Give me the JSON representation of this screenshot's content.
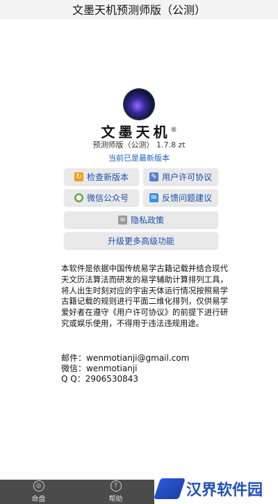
{
  "window": {
    "title": "文墨天机预测师版（公测）"
  },
  "about": {
    "brand": "文墨天机",
    "registered": "®",
    "version": "预测师版（公测） 1.7.8 zt",
    "latest_status": "当前已是最新版本"
  },
  "buttons": {
    "check_update": "检查新版本",
    "user_agreement": "用户许可协议",
    "wechat": "微信公众号",
    "feedback": "反馈问题建议",
    "privacy": "隐私政策",
    "upgrade": "升级更多高级功能"
  },
  "description": "本软件是依据中国传统易学古籍记载并结合现代天文历法算法而研发的易学辅助计算排列工具，将人出生时刻对应的宇宙天体运行情况按照易学古籍记载的规则进行平面二维化排列，仅供易学爱好者在遵守《用户许可协议》的前提下进行研究或娱乐使用，不得用于违法违规用途。",
  "contact": {
    "email_label": "邮件：",
    "email": "wenmotianji@gmail.com",
    "wechat_label": "微信：",
    "wechat": "wenmotianji",
    "qq_label": "Q Q：",
    "qq": "2906530843"
  },
  "bottom_nav": [
    {
      "label": "命盘",
      "icon": "chart-icon"
    },
    {
      "label": "帮助",
      "icon": "help-icon"
    }
  ],
  "watermark": {
    "text": "汉界软件园"
  },
  "colors": {
    "link_blue": "#1a4fae",
    "button_bg": "#e9e9e9",
    "nav_bg": "#4b4b4b"
  }
}
